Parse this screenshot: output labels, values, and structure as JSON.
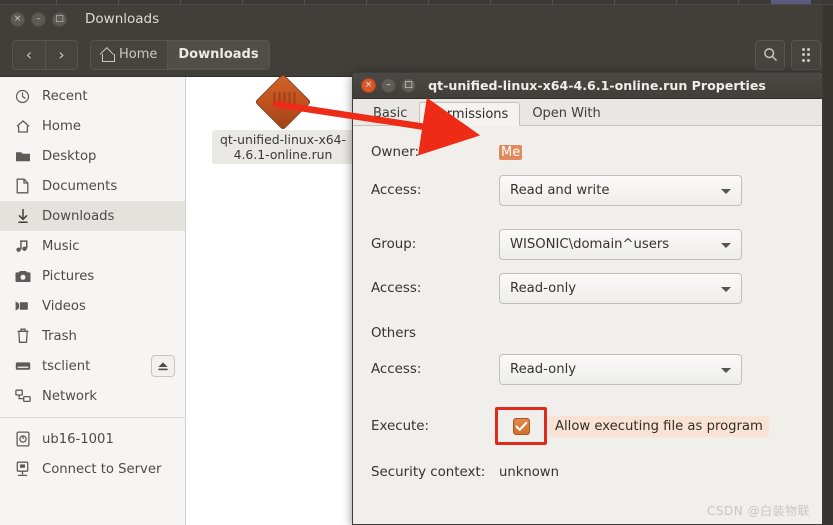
{
  "file_manager": {
    "window_title": "Downloads",
    "window_controls": {
      "close": "×",
      "minimize": "–",
      "maximize": "□"
    },
    "toolbar": {
      "back_label": "‹",
      "forward_label": "›",
      "breadcrumbs": [
        {
          "label": "Home",
          "icon": "home-icon",
          "active": false
        },
        {
          "label": "Downloads",
          "icon": "",
          "active": true
        }
      ],
      "search_label": "search-icon",
      "menu_label": "grid-menu-icon"
    },
    "sidebar": {
      "items": [
        {
          "label": "Recent",
          "icon": "clock-icon"
        },
        {
          "label": "Home",
          "icon": "home-icon"
        },
        {
          "label": "Desktop",
          "icon": "folder-icon"
        },
        {
          "label": "Documents",
          "icon": "document-icon"
        },
        {
          "label": "Downloads",
          "icon": "download-icon"
        },
        {
          "label": "Music",
          "icon": "music-icon"
        },
        {
          "label": "Pictures",
          "icon": "camera-icon"
        },
        {
          "label": "Videos",
          "icon": "video-icon"
        },
        {
          "label": "Trash",
          "icon": "trash-icon"
        },
        {
          "label": "tsclient",
          "icon": "drive-icon"
        },
        {
          "label": "Network",
          "icon": "network-icon"
        },
        {
          "label": "ub16-1001",
          "icon": "remote-disk-icon"
        },
        {
          "label": "Connect to Server",
          "icon": "server-icon"
        }
      ],
      "selected": "Downloads",
      "eject_item": "tsclient"
    },
    "file": {
      "name": "qt-unified-linux-x64-4.6.1-online.run",
      "icon": "executable-diamond-icon"
    }
  },
  "properties_dialog": {
    "title": "qt-unified-linux-x64-4.6.1-online.run Properties",
    "window_controls": {
      "close": "×",
      "minimize": "–",
      "maximize": "□"
    },
    "tabs": [
      {
        "label": "Basic",
        "active": false
      },
      {
        "label": "Permissions",
        "active": true
      },
      {
        "label": "Open With",
        "active": false
      }
    ],
    "fields": {
      "owner_label": "Owner:",
      "owner_value": "Me",
      "owner_access_label": "Access:",
      "owner_access_value": "Read and write",
      "group_label": "Group:",
      "group_value": "WISONIC\\domain^users",
      "group_access_label": "Access:",
      "group_access_value": "Read-only",
      "others_label": "Others",
      "others_access_label": "Access:",
      "others_access_value": "Read-only",
      "execute_label": "Execute:",
      "execute_checkbox_label": "Allow executing file as program",
      "execute_checked": true,
      "security_context_label": "Security context:",
      "security_context_value": "unknown"
    }
  },
  "annotations": {
    "arrow_color": "#ee2b16",
    "highlight_box_color": "#e02b1a",
    "highlight_fill_color": "#fbe3d4"
  },
  "watermark": {
    "text": "CSDN @白装物联"
  }
}
